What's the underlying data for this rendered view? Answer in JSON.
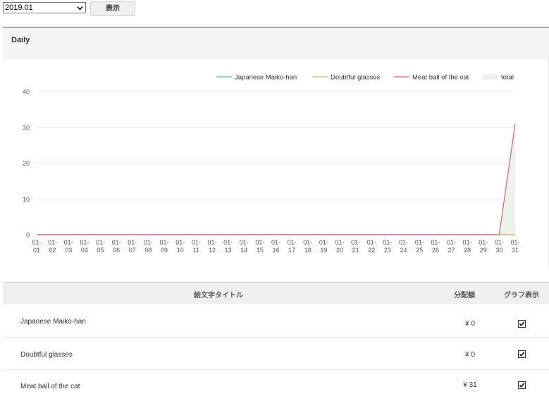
{
  "toolbar": {
    "month_value": "2019.01",
    "show_label": "表示"
  },
  "panel": {
    "title": "Daily"
  },
  "chart_data": {
    "type": "line",
    "title": "",
    "xlabel": "",
    "ylabel": "",
    "ylim": [
      0,
      40
    ],
    "yticks": [
      0,
      10,
      20,
      30,
      40
    ],
    "grid": true,
    "legend_position": "top-right",
    "categories": [
      "01-01",
      "01-02",
      "01-03",
      "01-04",
      "01-05",
      "01-06",
      "01-07",
      "01-08",
      "01-09",
      "01-10",
      "01-11",
      "01-12",
      "01-13",
      "01-14",
      "01-15",
      "01-16",
      "01-17",
      "01-18",
      "01-19",
      "01-20",
      "01-21",
      "01-22",
      "01-23",
      "01-24",
      "01-25",
      "01-26",
      "01-27",
      "01-28",
      "01-29",
      "01-30",
      "01-31"
    ],
    "series": [
      {
        "name": "Japanese Maiko-han",
        "color": "#4cc3a1",
        "style": "line",
        "values": [
          0,
          0,
          0,
          0,
          0,
          0,
          0,
          0,
          0,
          0,
          0,
          0,
          0,
          0,
          0,
          0,
          0,
          0,
          0,
          0,
          0,
          0,
          0,
          0,
          0,
          0,
          0,
          0,
          0,
          0,
          0
        ]
      },
      {
        "name": "Doubtful glasses",
        "color": "#f5a95b",
        "style": "line",
        "values": [
          0,
          0,
          0,
          0,
          0,
          0,
          0,
          0,
          0,
          0,
          0,
          0,
          0,
          0,
          0,
          0,
          0,
          0,
          0,
          0,
          0,
          0,
          0,
          0,
          0,
          0,
          0,
          0,
          0,
          0,
          0
        ]
      },
      {
        "name": "Meat ball of the cat",
        "color": "#e0588d",
        "style": "line",
        "values": [
          0,
          0,
          0,
          0,
          0,
          0,
          0,
          0,
          0,
          0,
          0,
          0,
          0,
          0,
          0,
          0,
          0,
          0,
          0,
          0,
          0,
          0,
          0,
          0,
          0,
          0,
          0,
          0,
          0,
          0,
          31
        ]
      },
      {
        "name": "total",
        "color": "#eef3ea",
        "style": "area",
        "values": [
          0,
          0,
          0,
          0,
          0,
          0,
          0,
          0,
          0,
          0,
          0,
          0,
          0,
          0,
          0,
          0,
          0,
          0,
          0,
          0,
          0,
          0,
          0,
          0,
          0,
          0,
          0,
          0,
          0,
          0,
          31
        ]
      }
    ]
  },
  "table": {
    "headers": {
      "title": "絵文字タイトル",
      "amount": "分配額",
      "graph": "グラフ表示"
    },
    "rows": [
      {
        "name": "Japanese Maiko-han",
        "amount": "¥ 0",
        "checked": true
      },
      {
        "name": "Doubtful glasses",
        "amount": "¥ 0",
        "checked": true
      },
      {
        "name": "Meat ball of the cat",
        "amount": "¥ 31",
        "checked": true
      }
    ]
  }
}
